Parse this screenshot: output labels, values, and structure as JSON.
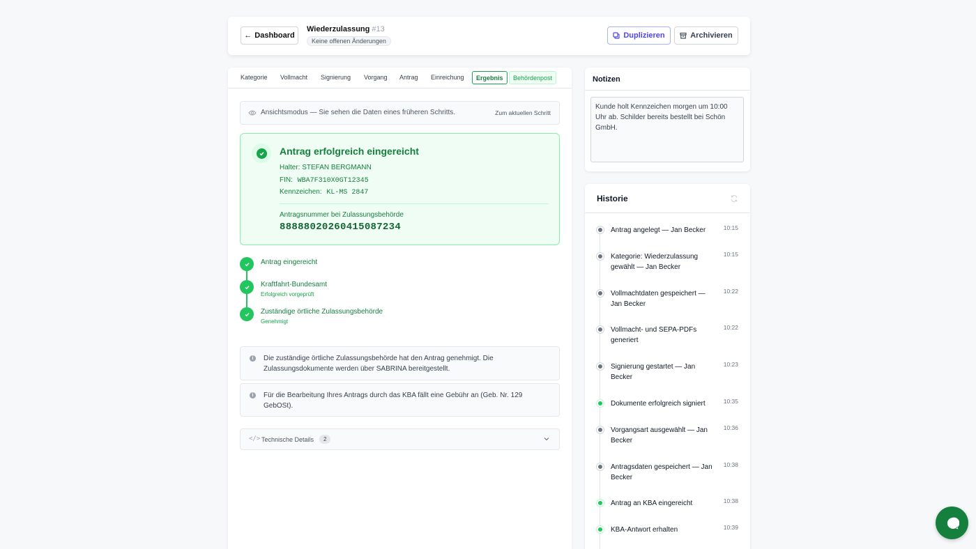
{
  "header": {
    "back_label": "Dashboard",
    "title": "Wiederzulassung",
    "number": "#13",
    "status_pill": "Keine offenen Änderungen",
    "duplicate_label": "Duplizieren",
    "archive_label": "Archivieren"
  },
  "tabs": [
    "Kategorie",
    "Vollmacht",
    "Signierung",
    "Vorgang",
    "Antrag",
    "Einreichung",
    "Ergebnis",
    "Behördenpost"
  ],
  "active_tab": "Ergebnis",
  "view_mode": {
    "text": "Ansichtsmodus — Sie sehen die Daten eines früheren Schritts.",
    "link": "Zum aktuellen Schritt"
  },
  "result": {
    "title": "Antrag erfolgreich eingereicht",
    "halter_label": "Halter:",
    "halter_value": "STEFAN BERGMANN",
    "fin_label": "FIN:",
    "fin_value": "WBA7F310X0GT12345",
    "kennzeichen_label": "Kennzeichen:",
    "kennzeichen_value": "KL-MS 2847",
    "antragsnummer_label": "Antragsnummer bei Zulassungsbehörde",
    "antragsnummer_value": "88888020260415087234"
  },
  "steps": [
    {
      "title": "Antrag eingereicht",
      "sub": ""
    },
    {
      "title": "Kraftfahrt-Bundesamt",
      "sub": "Erfolgreich vorgeprüft"
    },
    {
      "title": "Zuständige örtliche Zulassungsbehörde",
      "sub": "Genehmigt"
    }
  ],
  "info_messages": [
    "Die zuständige örtliche Zulassungsbehörde hat den Antrag genehmigt. Die Zulassungsdokumente werden über SABRINA bereitgestellt.",
    "Für die Bearbeitung Ihres Antrags durch das KBA fällt eine Gebühr an (Geb. Nr. 129 GebOSt)."
  ],
  "tech_details": {
    "label": "Technische Details",
    "count": "2"
  },
  "notes": {
    "title": "Notizen",
    "content": "Kunde holt Kennzeichen morgen um 10:00 Uhr ab. Schilder bereits bestellt bei Schön GmbH."
  },
  "history": {
    "title": "Historie",
    "items": [
      {
        "text": "Antrag angelegt — Jan Becker",
        "time": "10:15",
        "status": "grey"
      },
      {
        "text": "Kategorie: Wiederzulassung gewählt — Jan Becker",
        "time": "10:15",
        "status": "grey"
      },
      {
        "text": "Vollmachtdaten gespeichert — Jan Becker",
        "time": "10:22",
        "status": "grey"
      },
      {
        "text": "Vollmacht- und SEPA-PDFs generiert",
        "time": "10:22",
        "status": "grey"
      },
      {
        "text": "Signierung gestartet — Jan Becker",
        "time": "10:23",
        "status": "grey"
      },
      {
        "text": "Dokumente erfolgreich signiert",
        "time": "10:35",
        "status": "green"
      },
      {
        "text": "Vorgangsart ausgewählt — Jan Becker",
        "time": "10:36",
        "status": "grey"
      },
      {
        "text": "Antragsdaten gespeichert — Jan Becker",
        "time": "10:38",
        "status": "grey"
      },
      {
        "text": "Antrag an KBA eingereicht",
        "time": "10:38",
        "status": "green"
      },
      {
        "text": "KBA-Antwort erhalten",
        "time": "10:39",
        "status": "green"
      }
    ]
  },
  "colors": {
    "accent": "#16a34a",
    "primary": "#4f46e5",
    "chat": "#15803d"
  }
}
